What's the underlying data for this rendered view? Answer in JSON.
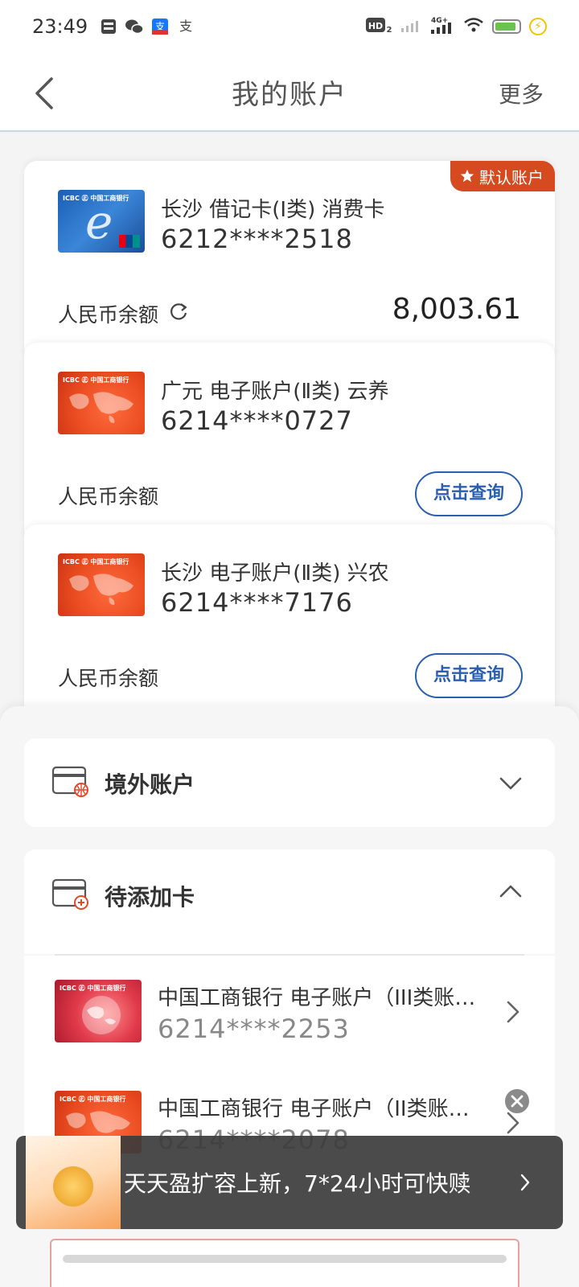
{
  "status_bar": {
    "time": "23:49",
    "network": "4G+",
    "hd": "HD",
    "icons": [
      "notification-icon",
      "wechat-icon",
      "alipay-icon",
      "alipay-small-icon"
    ]
  },
  "header": {
    "title": "我的账户",
    "more": "更多"
  },
  "accounts": [
    {
      "name": "长沙 借记卡(Ⅰ类) 消费卡",
      "number": "6212****2518",
      "balance_label": "人民币余额",
      "balance": "8,003.61",
      "tag": "默认账户"
    },
    {
      "name": "广元 电子账户(Ⅱ类) 云养",
      "number": "6214****0727",
      "balance_label": "人民币余额",
      "query": "点击查询"
    },
    {
      "name": "长沙 电子账户(Ⅱ类) 兴农",
      "number": "6214****7176",
      "balance_label": "人民币余额",
      "query": "点击查询"
    }
  ],
  "sections": {
    "overseas": "境外账户",
    "to_add": "待添加卡"
  },
  "pending_cards": [
    {
      "name": "中国工商银行  电子账户（III类账…",
      "number": "6214****2253"
    },
    {
      "name": "中国工商银行  电子账户（II类账…",
      "number": "6214****2078"
    }
  ],
  "promo": {
    "text": "天天盈扩容上新，7*24小时可快赎"
  },
  "colors": {
    "accent_blue": "#2a5fb0",
    "default_tag": "#d54a1f"
  }
}
